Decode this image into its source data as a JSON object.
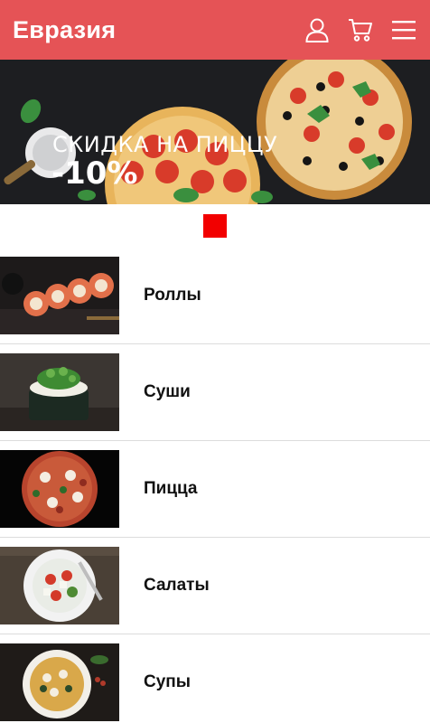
{
  "header": {
    "logo": "Евразия",
    "icons": [
      "user-icon",
      "cart-icon",
      "menu-icon"
    ]
  },
  "banner": {
    "line1": "СКИДКА НА ПИЦЦУ",
    "line2": "-10%"
  },
  "carousel": {
    "active_index": 0,
    "count": 1,
    "active_color": "#f20000"
  },
  "categories": [
    {
      "label": "Роллы",
      "image": "rolls"
    },
    {
      "label": "Суши",
      "image": "sushi"
    },
    {
      "label": "Пицца",
      "image": "pizza"
    },
    {
      "label": "Салаты",
      "image": "salad"
    },
    {
      "label": "Супы",
      "image": "soup"
    }
  ],
  "colors": {
    "header_bg": "#e55356",
    "banner_bg": "#1d1e21"
  }
}
